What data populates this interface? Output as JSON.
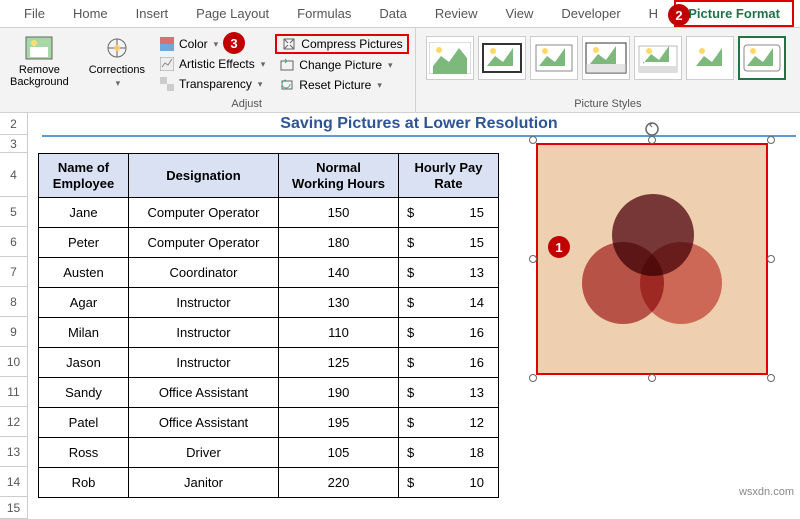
{
  "tabs": [
    "File",
    "Home",
    "Insert",
    "Page Layout",
    "Formulas",
    "Data",
    "Review",
    "View",
    "Developer",
    "H"
  ],
  "active_tab": "Picture Format",
  "ribbon": {
    "remove_bg": "Remove\nBackground",
    "corrections": "Corrections",
    "color": "Color",
    "artistic": "Artistic Effects",
    "transparency": "Transparency",
    "adjust_label": "Adjust",
    "compress": "Compress Pictures",
    "change": "Change Picture",
    "reset": "Reset Picture",
    "styles_label": "Picture Styles"
  },
  "sheet": {
    "title": "Saving Pictures at Lower Resolution",
    "headers": [
      "Name of\nEmployee",
      "Designation",
      "Normal\nWorking Hours",
      "Hourly Pay\nRate"
    ],
    "rows": [
      {
        "name": "Jane",
        "desig": "Computer Operator",
        "hours": "150",
        "rate": "15"
      },
      {
        "name": "Peter",
        "desig": "Computer Operator",
        "hours": "180",
        "rate": "15"
      },
      {
        "name": "Austen",
        "desig": "Coordinator",
        "hours": "140",
        "rate": "13"
      },
      {
        "name": "Agar",
        "desig": "Instructor",
        "hours": "130",
        "rate": "14"
      },
      {
        "name": "Milan",
        "desig": "Instructor",
        "hours": "110",
        "rate": "16"
      },
      {
        "name": "Jason",
        "desig": "Instructor",
        "hours": "125",
        "rate": "16"
      },
      {
        "name": "Sandy",
        "desig": "Office Assistant",
        "hours": "190",
        "rate": "13"
      },
      {
        "name": "Patel",
        "desig": "Office Assistant",
        "hours": "195",
        "rate": "12"
      },
      {
        "name": "Ross",
        "desig": "Driver",
        "hours": "105",
        "rate": "18"
      },
      {
        "name": "Rob",
        "desig": "Janitor",
        "hours": "220",
        "rate": "10"
      }
    ],
    "row_nums": [
      "2",
      "3",
      "4",
      "5",
      "6",
      "7",
      "8",
      "9",
      "10",
      "11",
      "12",
      "13",
      "14",
      "15"
    ]
  },
  "callouts": {
    "c1": "1",
    "c2": "2",
    "c3": "3"
  },
  "watermark": "wsxdn.com"
}
